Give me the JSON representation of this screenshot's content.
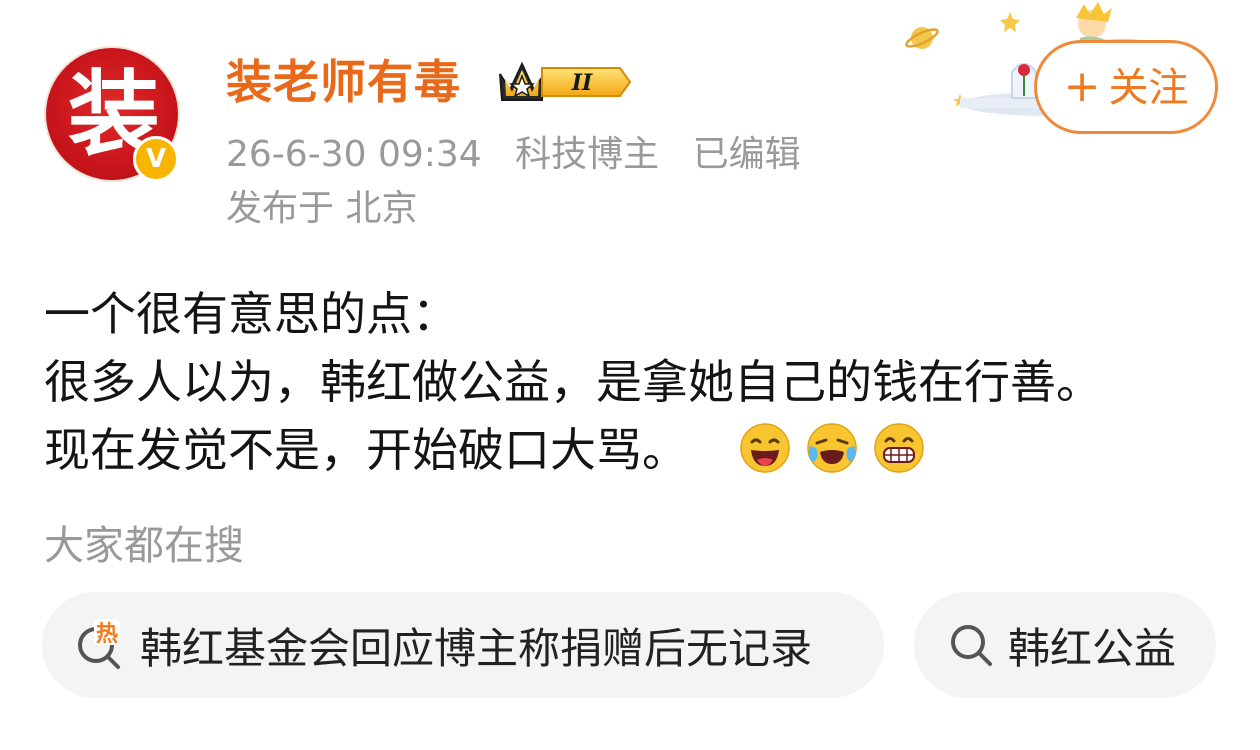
{
  "user": {
    "name": "装老师有毒",
    "avatar_glyph": "装",
    "verified_badge": "V",
    "crown_level": "II"
  },
  "meta": {
    "timestamp": "26-6-30 09:34",
    "category": "科技博主",
    "edited": "已编辑",
    "location": "发布于 北京"
  },
  "follow_button": {
    "plus": "+",
    "label": "关注"
  },
  "post": {
    "lines": [
      "一个很有意思的点：",
      "很多人以为，韩红做公益，是拿她自己的钱在行善。",
      "现在发觉不是，开始破口大骂。"
    ],
    "emojis": [
      "laughing-emoji",
      "crying-laughing-emoji",
      "grinning-emoji"
    ]
  },
  "search": {
    "heading": "大家都在搜",
    "chips": [
      {
        "text": "韩红基金会回应博主称捐赠后无记录",
        "icon": "hot-search-icon",
        "hot_label": "热"
      },
      {
        "text": "韩红公益",
        "icon": "search-icon"
      }
    ]
  },
  "colors": {
    "accent_orange": "#e8691a",
    "follow_border": "#f08a3a",
    "meta_gray": "#999999",
    "chip_bg": "#f4f4f4",
    "avatar_red": "#c8151b"
  }
}
